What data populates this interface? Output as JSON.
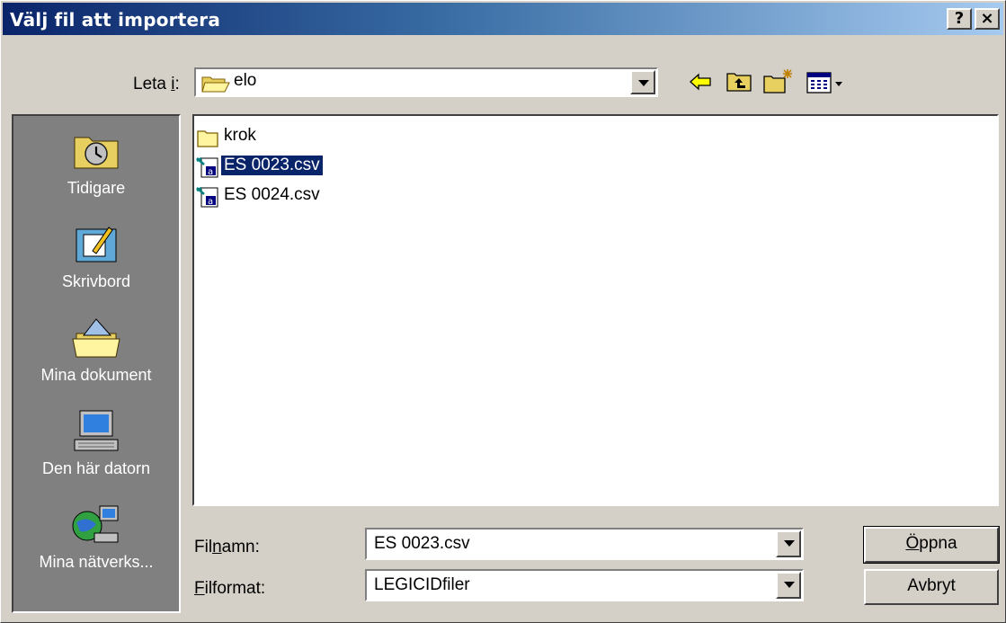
{
  "window": {
    "title": "Välj fil att importera",
    "help_label": "?",
    "close_label": "×"
  },
  "lookin": {
    "label_prefix": "Leta ",
    "label_access": "i",
    "label_suffix": ":",
    "value": "elo"
  },
  "places": [
    {
      "label": "Tidigare",
      "icon": "history-icon"
    },
    {
      "label": "Skrivbord",
      "icon": "desktop-icon"
    },
    {
      "label": "Mina dokument",
      "icon": "my-documents-icon"
    },
    {
      "label": "Den här datorn",
      "icon": "my-computer-icon"
    },
    {
      "label": "Mina nätverks...",
      "icon": "network-places-icon"
    }
  ],
  "files": [
    {
      "name": "krok",
      "type": "folder"
    },
    {
      "name": "ES 0023.csv",
      "type": "csv",
      "selected": true
    },
    {
      "name": "ES 0024.csv",
      "type": "csv"
    }
  ],
  "filename": {
    "label_prefix": "Fil",
    "label_access": "n",
    "label_suffix": "amn:",
    "value": "ES 0023.csv"
  },
  "filetype": {
    "label_access": "F",
    "label_suffix": "ilformat:",
    "value": "LEGICIDfiler"
  },
  "buttons": {
    "open_access": "Ö",
    "open_rest": "ppna",
    "cancel": "Avbryt"
  },
  "colors": {
    "title_start": "#0a246a",
    "title_end": "#a6caf0",
    "selection": "#0a246a",
    "face": "#d4d0c8",
    "places_bg": "#808080"
  }
}
